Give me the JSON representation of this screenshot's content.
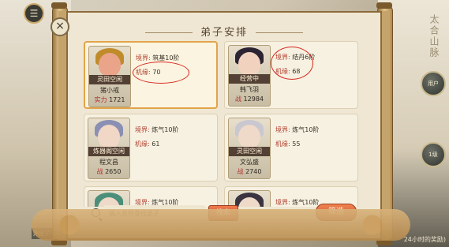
{
  "panel": {
    "title": "弟子安排",
    "close_glyph": "×"
  },
  "cards": [
    {
      "status": "灵田空闲",
      "name": "猪小戒",
      "power_label": "实力",
      "power": "1721",
      "realm_label": "境界:",
      "realm": "筑基10阶",
      "fortune_label": "机缘:",
      "fortune": "70",
      "hair_color": "#c08b2a",
      "face_color": "#e9a48a"
    },
    {
      "status": "经营中",
      "name": "韩飞羽",
      "power_label": "战",
      "power": "12984",
      "realm_label": "境界:",
      "realm": "结丹6阶",
      "fortune_label": "机缘:",
      "fortune": "68",
      "hair_color": "#2d2433",
      "face_color": "#f0d2bf"
    },
    {
      "status": "炼器阁空闲",
      "name": "程文昌",
      "power_label": "战",
      "power": "2650",
      "realm_label": "境界:",
      "realm": "炼气10阶",
      "fortune_label": "机缘:",
      "fortune": "61",
      "hair_color": "#8a8fb3",
      "face_color": "#f0d7c6"
    },
    {
      "status": "灵田空闲",
      "name": "文弘盛",
      "power_label": "战",
      "power": "2740",
      "realm_label": "境界:",
      "realm": "炼气10阶",
      "fortune_label": "机缘:",
      "fortune": "55",
      "hair_color": "#c9c7cf",
      "face_color": "#efd9c9"
    },
    {
      "status": "",
      "name": "",
      "power_label": "",
      "power": "",
      "realm_label": "境界:",
      "realm": "炼气10阶",
      "fortune_label": "",
      "fortune": "",
      "hair_color": "#4b8f7a",
      "face_color": "#efd9c9"
    },
    {
      "status": "",
      "name": "",
      "power_label": "",
      "power": "",
      "realm_label": "境界:",
      "realm": "炼气10阶",
      "fortune_label": "",
      "fortune": "",
      "hair_color": "#3b3440",
      "face_color": "#efd9c9"
    }
  ],
  "search": {
    "placeholder": "输入名称查找弟子",
    "button_label": "搜索"
  },
  "filter_label": "筛选",
  "background": {
    "right_title": "太合山脉",
    "right_button_1": "用户",
    "right_button_2": "1级",
    "bottom_right_text": "24小时的奖励)",
    "left_side_text": "外出了"
  },
  "colors": {
    "accent": "#e2a44a",
    "button_red": "#c84e2b",
    "annotation_red": "#d6271f"
  }
}
